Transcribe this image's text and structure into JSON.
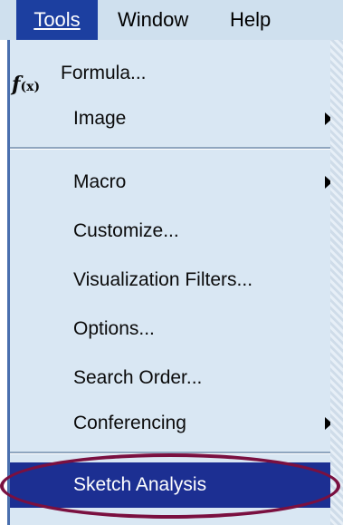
{
  "menubar": {
    "items": [
      {
        "label": "Tools",
        "underline": "T",
        "active": true
      },
      {
        "label": "Window",
        "underline": "W"
      },
      {
        "label": "Help",
        "underline": "H"
      }
    ]
  },
  "menu": {
    "items": [
      {
        "label": "Formula...",
        "icon": "fx-icon",
        "has_submenu": false
      },
      {
        "label": "Image",
        "has_submenu": true
      },
      {
        "label": "Macro",
        "has_submenu": true
      },
      {
        "label": "Customize...",
        "has_submenu": false
      },
      {
        "label": "Visualization Filters...",
        "has_submenu": false
      },
      {
        "label": "Options...",
        "has_submenu": false
      },
      {
        "label": "Search Order...",
        "has_submenu": false
      },
      {
        "label": "Conferencing",
        "has_submenu": true
      },
      {
        "label": "Sketch Analysis",
        "has_submenu": false,
        "selected": true
      }
    ]
  },
  "colors": {
    "menubar_bg": "#cfe0ee",
    "menu_bg": "#d9e7f3",
    "highlight": "#1c2f92",
    "annotation_oval": "#7a1040"
  }
}
